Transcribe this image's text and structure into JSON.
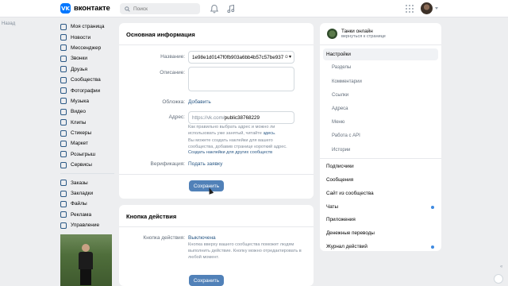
{
  "header": {
    "logo_letters": "VK",
    "logo_text": "вконтакте",
    "search_placeholder": "Поиск",
    "icons": [
      "bell-icon",
      "music-icon",
      "apps-grid-icon"
    ]
  },
  "back_label": "Назад",
  "sidebar": {
    "items_main": [
      {
        "label": "Моя страница",
        "icon": "home-icon"
      },
      {
        "label": "Новости",
        "icon": "news-icon"
      },
      {
        "label": "Мессенджер",
        "icon": "messenger-icon"
      },
      {
        "label": "Звонки",
        "icon": "phone-icon"
      },
      {
        "label": "Друзья",
        "icon": "friends-icon"
      },
      {
        "label": "Сообщества",
        "icon": "communities-icon"
      },
      {
        "label": "Фотографии",
        "icon": "photo-icon"
      },
      {
        "label": "Музыка",
        "icon": "music-icon"
      },
      {
        "label": "Видео",
        "icon": "video-icon"
      },
      {
        "label": "Клипы",
        "icon": "clips-icon"
      },
      {
        "label": "Стикеры",
        "icon": "sticker-icon"
      },
      {
        "label": "Маркет",
        "icon": "market-icon"
      },
      {
        "label": "Розыгрыш",
        "icon": "gift-icon"
      },
      {
        "label": "Сервисы",
        "icon": "services-icon"
      }
    ],
    "items_secondary": [
      {
        "label": "Заказы",
        "icon": "orders-icon"
      },
      {
        "label": "Закладки",
        "icon": "bookmark-icon"
      },
      {
        "label": "Файлы",
        "icon": "files-icon"
      },
      {
        "label": "Реклама",
        "icon": "ads-icon"
      },
      {
        "label": "Управление",
        "icon": "manage-icon"
      }
    ]
  },
  "basic_info": {
    "title": "Основная информация",
    "name_label": "Название:",
    "name_value": "1e98e1d0147f0fb903a6bb4b57c57be937",
    "description_label": "Описание:",
    "cover_label": "Обложка:",
    "cover_link": "Добавить",
    "address_label": "Адрес:",
    "address_prefix": "https://vk.com/",
    "address_value": "public38768229",
    "address_hint": "Как правильно выбрать адрес и можно ли использовать уже занятый, читайте",
    "address_hint_link": "здесь",
    "sticker_hint": "Вы можете создать наклейки для вашего сообщества, добавив странице короткий адрес.",
    "sticker_link": "Создать наклейки для других сообществ",
    "verification_label": "Верификация:",
    "verification_link": "Подать заявку",
    "save_label": "Сохранить"
  },
  "action_button": {
    "title": "Кнопка действия",
    "label": "Кнопка действия:",
    "value": "Выключена",
    "hint": "Кнопка вверху вашего сообщества поможет людям выполнить действие. Кнопку можно отредактировать в любой момент.",
    "save_label": "Сохранить"
  },
  "right_panel": {
    "group_name": "Танки онлайн",
    "group_back": "вернуться к странице",
    "items": [
      {
        "label": "Настройки",
        "type": "active",
        "dot": false
      },
      {
        "label": "Разделы",
        "type": "sub",
        "dot": false
      },
      {
        "label": "Комментарии",
        "type": "sub",
        "dot": false
      },
      {
        "label": "Ссылки",
        "type": "sub",
        "dot": false
      },
      {
        "label": "Адреса",
        "type": "sub",
        "dot": false
      },
      {
        "label": "Меню",
        "type": "sub",
        "dot": false
      },
      {
        "label": "Работа с API",
        "type": "sub",
        "dot": false
      },
      {
        "label": "Истории",
        "type": "sub",
        "dot": false
      },
      {
        "label": "Подписчики",
        "type": "main",
        "dot": false
      },
      {
        "label": "Сообщения",
        "type": "main",
        "dot": false
      },
      {
        "label": "Сайт из сообщества",
        "type": "main",
        "dot": false
      },
      {
        "label": "Чаты",
        "type": "main",
        "dot": true
      },
      {
        "label": "Приложения",
        "type": "main",
        "dot": false
      },
      {
        "label": "Денежные переводы",
        "type": "main",
        "dot": false
      },
      {
        "label": "Журнал действий",
        "type": "main",
        "dot": true
      }
    ]
  },
  "collapse_glyph": "«"
}
